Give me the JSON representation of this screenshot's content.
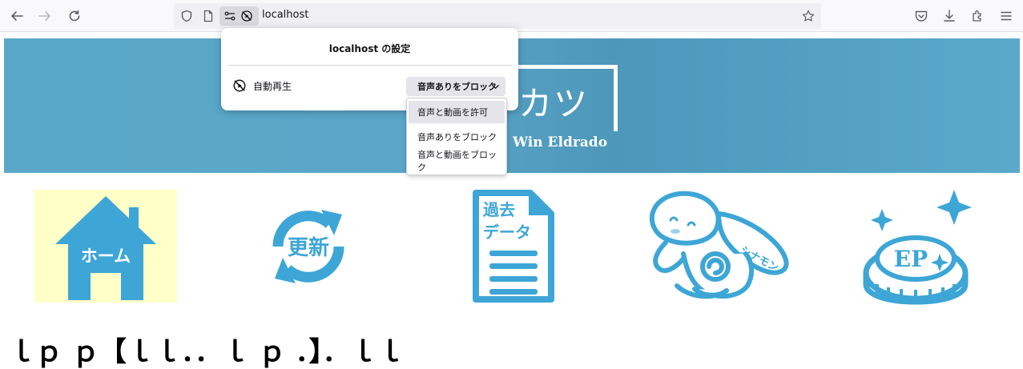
{
  "browser": {
    "url": "localhost",
    "icons": {
      "back": "back-arrow-icon",
      "forward": "forward-arrow-icon",
      "reload": "reload-icon",
      "shield": "tracking-protection-shield-icon",
      "page": "page-info-icon",
      "permissions": "permissions-icon",
      "autoplay_blocked": "autoplay-blocked-icon",
      "bookmark": "star-bookmark-icon",
      "pocket": "pocket-icon",
      "downloads": "download-icon",
      "extensions": "extensions-icon",
      "menu": "hamburger-menu-icon"
    }
  },
  "permissions_popup": {
    "title": "localhost の設定",
    "autoplay_label": "自動再生",
    "selected": "音声ありをブロック",
    "options": [
      {
        "label": "音声と動画を許可",
        "highlighted": true
      },
      {
        "label": "音声ありをブロック",
        "highlighted": false
      },
      {
        "label": "音声と動画をブロック",
        "highlighted": false
      }
    ]
  },
  "page": {
    "banner": {
      "title_fragment": "カツ",
      "subtitle": "Win Eldrado"
    },
    "nav": [
      {
        "label": "ホーム",
        "icon": "home-icon"
      },
      {
        "label": "更新",
        "icon": "update-refresh-icon"
      },
      {
        "label": "過去データ",
        "label_line1": "過去",
        "label_line2": "データ",
        "icon": "document-icon"
      },
      {
        "label": "シナモン",
        "icon": "cinnamoroll-icon"
      },
      {
        "label": "EP",
        "icon": "ep-coin-icon"
      }
    ],
    "section_heading": "ｌｐ ｐ【ｌｌ．．ｌ ｐ ．】．ｌｌ"
  },
  "colors": {
    "accent_blue": "#3da6d6",
    "banner_blue": "#5aa8c9",
    "home_bg": "#ffffc8"
  }
}
